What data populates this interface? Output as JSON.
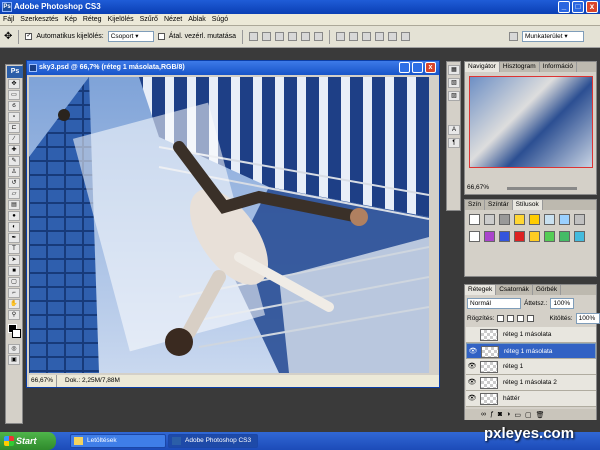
{
  "app": {
    "title": "Adobe Photoshop CS3",
    "icon": "Ps"
  },
  "window_buttons": {
    "minimize": "_",
    "maximize": "□",
    "close": "x"
  },
  "menu": [
    "Fájl",
    "Szerkesztés",
    "Kép",
    "Réteg",
    "Kijelölés",
    "Szűrő",
    "Nézet",
    "Ablak",
    "Súgó"
  ],
  "options": {
    "auto_select_label": "Automatikus kijelölés:",
    "auto_select_checked": "✓",
    "group_value": "Csoport",
    "transform_label": "Átal. vezérl. mutatása",
    "workspace_label": "Munkaterület ▾"
  },
  "tools": {
    "logo": "Ps"
  },
  "document": {
    "title": "sky3.psd @ 66,7% (réteg 1 másolata,RGB/8)",
    "zoom": "66,67%",
    "doc_info": "Dok.: 2,25M/7,88M"
  },
  "navigator": {
    "tabs": [
      "Navigátor",
      "Hisztogram",
      "Információ"
    ],
    "zoom": "66,67%"
  },
  "styles": {
    "tabs": [
      "Szín",
      "Színtár",
      "Stílusok"
    ],
    "swatch_colors": [
      "#ffffff",
      "#cccccc",
      "#999999",
      "#ffd633",
      "#ffcc00",
      "#c8e0f0",
      "#9ad0ff",
      "#c0c0c0",
      "#ffffff",
      "#aa44cc",
      "#3355dd",
      "#dd2222",
      "#ffcc22",
      "#55cc55",
      "#44bb66",
      "#44bbdd"
    ]
  },
  "layers": {
    "tabs": [
      "Rétegek",
      "Csatornák",
      "Görbék"
    ],
    "blend_mode": "Normál",
    "opacity_label": "Áttetsz.:",
    "opacity_value": "100%",
    "lock_label": "Rögzítés:",
    "fill_label": "Kitöltés:",
    "fill_value": "100%",
    "items": [
      {
        "name": "réteg 1 másolata",
        "visible": false,
        "selected": false
      },
      {
        "name": "réteg 1 másolata",
        "visible": true,
        "selected": true
      },
      {
        "name": "réteg 1",
        "visible": true,
        "selected": false
      },
      {
        "name": "réteg 1 másolata 2",
        "visible": true,
        "selected": false
      },
      {
        "name": "háttér",
        "visible": true,
        "selected": false
      }
    ]
  },
  "taskbar": {
    "start": "Start",
    "items": [
      "Letöltések",
      "Adobe Photoshop CS3"
    ],
    "watermark": "pxleyes.com"
  }
}
